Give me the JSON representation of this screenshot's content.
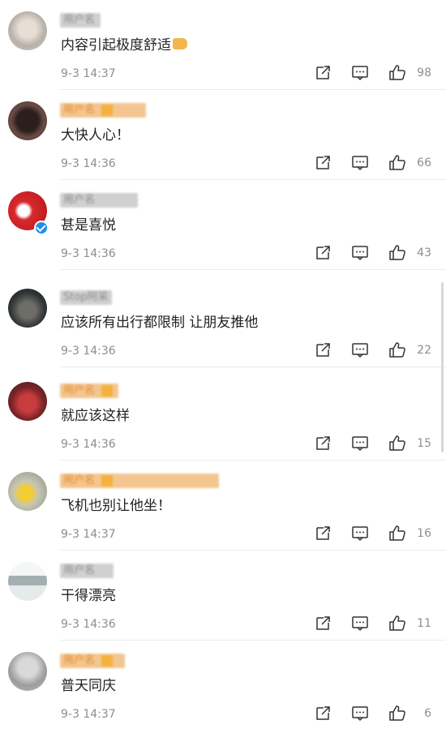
{
  "comments": [
    {
      "name": "用户名",
      "text": "内容引起极度舒适",
      "has_thumb_emoji": true,
      "time": "9-3 14:37",
      "likes": "98",
      "name_color": "gray",
      "verified": false,
      "avatar": "av-a"
    },
    {
      "name": "用户名",
      "text": "大快人心！",
      "time": "9-3 14:36",
      "likes": "66",
      "name_color": "orange",
      "verified": false,
      "avatar": "av-b"
    },
    {
      "name": "用户名",
      "text": "甚是喜悦",
      "time": "9-3 14:36",
      "likes": "43",
      "name_color": "gray",
      "verified": true,
      "avatar": "av-c"
    },
    {
      "name": "Stop阿呆",
      "text": "应该所有出行都限制 让朋友推他",
      "time": "9-3 14:36",
      "likes": "22",
      "name_color": "gray",
      "verified": false,
      "avatar": "av-d"
    },
    {
      "name": "用户名",
      "text": "就应该这样",
      "time": "9-3 14:36",
      "likes": "15",
      "name_color": "orange",
      "verified": false,
      "avatar": "av-e"
    },
    {
      "name": "用户名",
      "text": "飞机也别让他坐！",
      "time": "9-3 14:37",
      "likes": "16",
      "name_color": "orange",
      "verified": false,
      "avatar": "av-f"
    },
    {
      "name": "用户名",
      "text": "干得漂亮",
      "time": "9-3 14:36",
      "likes": "11",
      "name_color": "gray",
      "verified": false,
      "avatar": "av-g"
    },
    {
      "name": "用户名",
      "text": "普天同庆",
      "time": "9-3 14:37",
      "likes": "6",
      "name_color": "orange",
      "verified": false,
      "avatar": "av-h"
    }
  ],
  "icons": {
    "share": "share-icon",
    "comment": "comment-icon",
    "like": "thumbs-up-icon"
  },
  "colors": {
    "time_gray": "#8e8e8e",
    "name_orange": "#e48a2a",
    "verified_blue": "#1f8fe8"
  }
}
